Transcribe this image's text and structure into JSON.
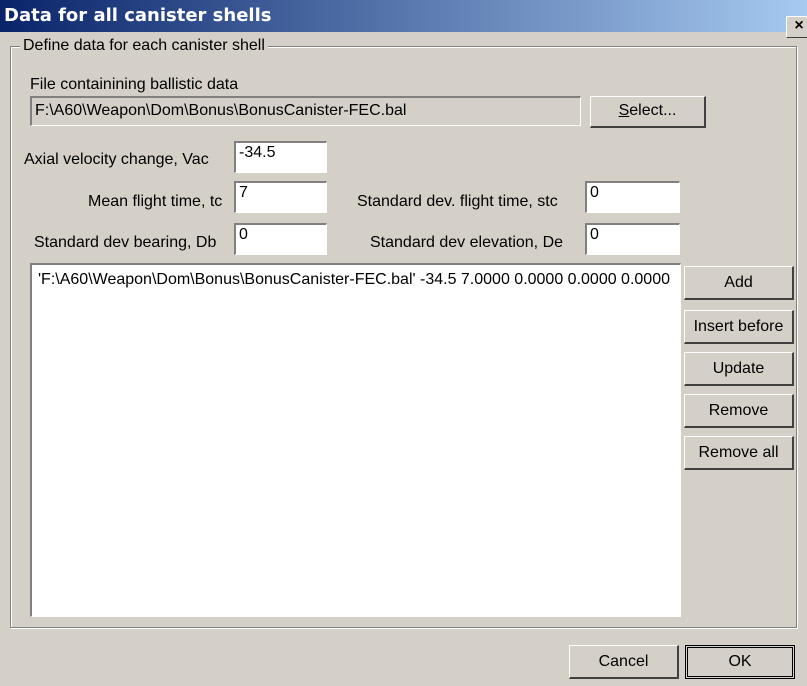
{
  "window": {
    "title": "Data for all canister shells",
    "close_glyph": "×"
  },
  "group": {
    "label": "Define data for each canister shell"
  },
  "file": {
    "label": "File containining ballistic data",
    "path": "F:\\A60\\Weapon\\Dom\\Bonus\\BonusCanister-FEC.bal",
    "select_label_hot": "S",
    "select_label_rest": "elect..."
  },
  "fields": {
    "axial_velocity": {
      "label": "Axial velocity change, Vac",
      "value": "-34.5"
    },
    "mean_flight_time": {
      "label": "Mean flight time, tc",
      "value": "7"
    },
    "std_flight_time": {
      "label": "Standard dev. flight time, stc",
      "value": "0"
    },
    "std_bearing": {
      "label": "Standard dev bearing, Db",
      "value": "0"
    },
    "std_elevation": {
      "label": "Standard dev elevation, De",
      "value": "0"
    }
  },
  "list": {
    "items": [
      "'F:\\A60\\Weapon\\Dom\\Bonus\\BonusCanister-FEC.bal'  -34.5  7.0000  0.0000  0.0000  0.0000"
    ]
  },
  "side_buttons": {
    "add": "Add",
    "insert_before": "Insert before",
    "update": "Update",
    "remove": "Remove",
    "remove_all": "Remove all"
  },
  "footer": {
    "cancel": "Cancel",
    "ok": "OK"
  }
}
